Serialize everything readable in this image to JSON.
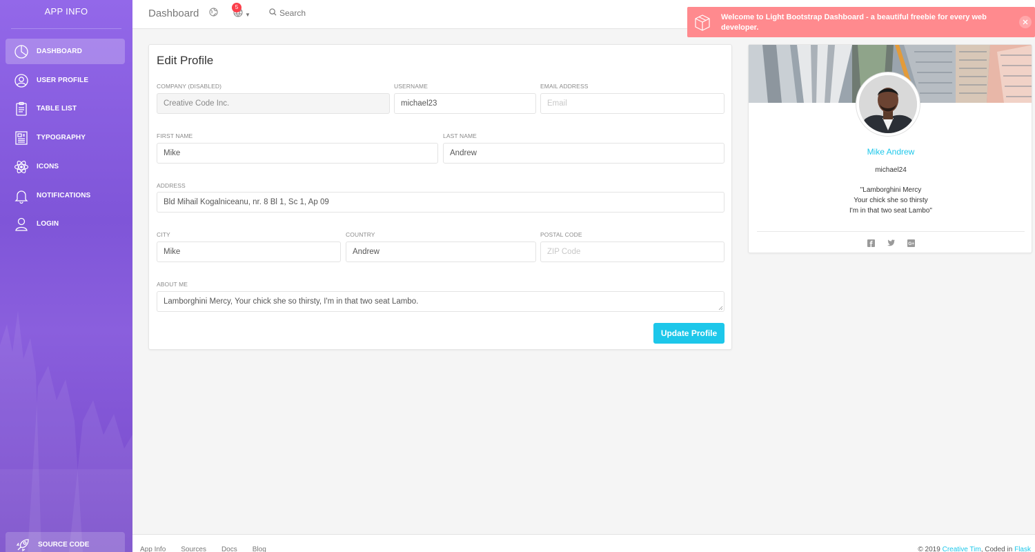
{
  "sidebar": {
    "brand": "APP INFO",
    "items": [
      {
        "label": "DASHBOARD",
        "icon": "chart-pie-icon"
      },
      {
        "label": "USER PROFILE",
        "icon": "user-circle-icon"
      },
      {
        "label": "TABLE LIST",
        "icon": "clipboard-icon"
      },
      {
        "label": "TYPOGRAPHY",
        "icon": "newspaper-icon"
      },
      {
        "label": "ICONS",
        "icon": "atom-icon"
      },
      {
        "label": "NOTIFICATIONS",
        "icon": "bell-icon"
      },
      {
        "label": "LOGIN",
        "icon": "user-icon"
      }
    ],
    "source_code": "SOURCE CODE"
  },
  "topbar": {
    "title": "Dashboard",
    "notification_count": "5",
    "search_label": "Search"
  },
  "toast": {
    "message": "Welcome to Light Bootstrap Dashboard - a beautiful freebie for every web developer."
  },
  "edit_profile": {
    "title": "Edit Profile",
    "company": {
      "label": "COMPANY (DISABLED)",
      "value": "Creative Code Inc."
    },
    "username": {
      "label": "USERNAME",
      "value": "michael23"
    },
    "email": {
      "label": "EMAIL ADDRESS",
      "placeholder": "Email"
    },
    "first_name": {
      "label": "FIRST NAME",
      "value": "Mike"
    },
    "last_name": {
      "label": "LAST NAME",
      "value": "Andrew"
    },
    "address": {
      "label": "ADDRESS",
      "value": "Bld Mihail Kogalniceanu, nr. 8 Bl 1, Sc 1, Ap 09"
    },
    "city": {
      "label": "CITY",
      "value": "Mike"
    },
    "country": {
      "label": "COUNTRY",
      "value": "Andrew"
    },
    "postal_code": {
      "label": "POSTAL CODE",
      "placeholder": "ZIP Code"
    },
    "about": {
      "label": "ABOUT ME",
      "value": "Lamborghini Mercy, Your chick she so thirsty, I'm in that two seat Lambo."
    },
    "submit_label": "Update Profile"
  },
  "user_card": {
    "name": "Mike Andrew",
    "handle": "michael24",
    "quote_lines": [
      "\"Lamborghini Mercy",
      "Your chick she so thirsty",
      "I'm in that two seat Lambo\""
    ],
    "socials": [
      "facebook-icon",
      "twitter-icon",
      "google-plus-icon"
    ]
  },
  "footer": {
    "links": [
      "App Info",
      "Sources",
      "Docs",
      "Blog"
    ],
    "copyright_prefix": "© 2019",
    "author": "Creative Tim",
    "coded_in": ", Coded in",
    "framework": "Flask"
  },
  "colors": {
    "accent": "#1dc7ea",
    "sidebar": "#8a5fdd",
    "toast": "#ff8a8e",
    "badge": "#fb404b"
  }
}
